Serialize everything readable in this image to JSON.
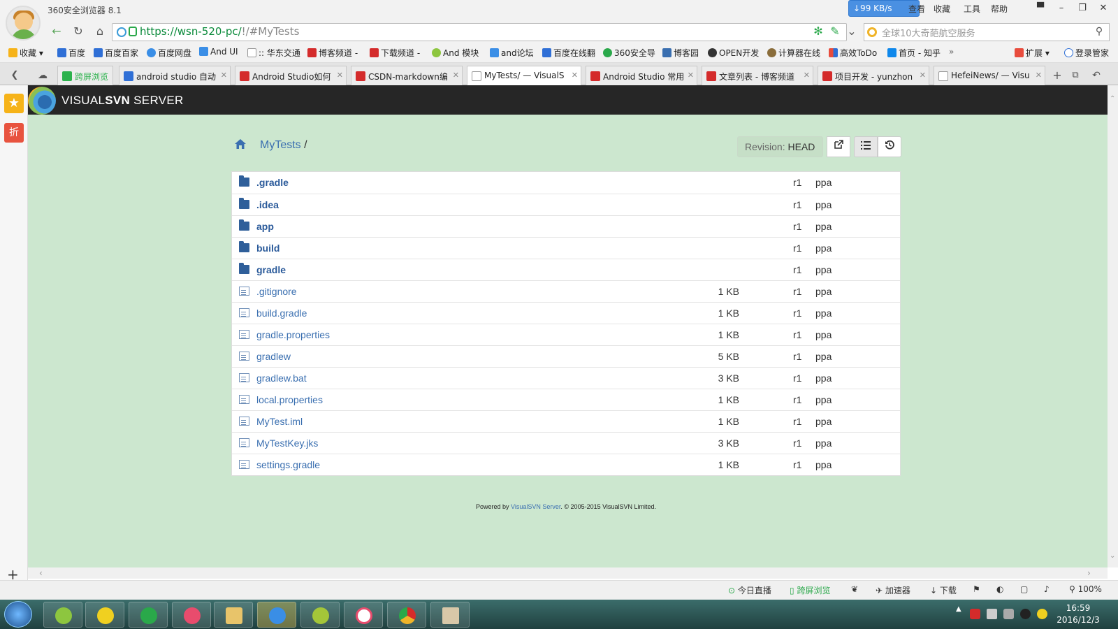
{
  "browser": {
    "app_title": "360安全浏览器 8.1",
    "speed": "↓99 KB/s",
    "menu": [
      "查看",
      "收藏",
      "工具",
      "帮助"
    ],
    "url_prefix": "https://wsn-520-pc/",
    "url_suffix": "!/#MyTests",
    "search_placeholder": "全球10大奇葩航空服务",
    "bookmarks": [
      "收藏",
      "百度",
      "百度百家",
      "百度网盘",
      "And UI",
      ":: 华东交通",
      "博客频道 -",
      "下载频道 -",
      "And 模块",
      "and论坛",
      "百度在线翻",
      "360安全导",
      "博客园",
      "OPEN开发",
      "计算器在线",
      "高效ToDo",
      "首页 - 知乎",
      "扩展",
      "登录管家"
    ],
    "tabs": [
      {
        "label": "跨屏浏览",
        "color": "#2bb24c"
      },
      {
        "label": "android studio 自动",
        "color": "#2f6fd6"
      },
      {
        "label": "Android Studio如何",
        "color": "#d42b2b"
      },
      {
        "label": "CSDN-markdown编",
        "color": "#d42b2b"
      },
      {
        "label": "MyTests/ — VisualS",
        "color": "#999999"
      },
      {
        "label": "Android Studio 常用",
        "color": "#d42b2b"
      },
      {
        "label": "文章列表 - 博客频道",
        "color": "#d42b2b"
      },
      {
        "label": "项目开发 - yunzhon",
        "color": "#d42b2b"
      },
      {
        "label": "HefeiNews/ — Visu",
        "color": "#999999"
      }
    ],
    "sidebar_deal": "折"
  },
  "svn": {
    "brand_light": "VISUAL",
    "brand_bold": "SVN",
    "brand_rest": " SERVER",
    "crumb": "MyTests",
    "crumb_sep": " /",
    "revision_label": "Revision:",
    "revision_value": "HEAD",
    "entries": [
      {
        "name": ".gradle",
        "type": "dir",
        "size": "",
        "rev": "r1",
        "author": "ppa"
      },
      {
        "name": ".idea",
        "type": "dir",
        "size": "",
        "rev": "r1",
        "author": "ppa"
      },
      {
        "name": "app",
        "type": "dir",
        "size": "",
        "rev": "r1",
        "author": "ppa"
      },
      {
        "name": "build",
        "type": "dir",
        "size": "",
        "rev": "r1",
        "author": "ppa"
      },
      {
        "name": "gradle",
        "type": "dir",
        "size": "",
        "rev": "r1",
        "author": "ppa"
      },
      {
        "name": ".gitignore",
        "type": "file",
        "size": "1 KB",
        "rev": "r1",
        "author": "ppa"
      },
      {
        "name": "build.gradle",
        "type": "file",
        "size": "1 KB",
        "rev": "r1",
        "author": "ppa"
      },
      {
        "name": "gradle.properties",
        "type": "file",
        "size": "1 KB",
        "rev": "r1",
        "author": "ppa"
      },
      {
        "name": "gradlew",
        "type": "file",
        "size": "5 KB",
        "rev": "r1",
        "author": "ppa"
      },
      {
        "name": "gradlew.bat",
        "type": "file",
        "size": "3 KB",
        "rev": "r1",
        "author": "ppa"
      },
      {
        "name": "local.properties",
        "type": "file",
        "size": "1 KB",
        "rev": "r1",
        "author": "ppa"
      },
      {
        "name": "MyTest.iml",
        "type": "file",
        "size": "1 KB",
        "rev": "r1",
        "author": "ppa"
      },
      {
        "name": "MyTestKey.jks",
        "type": "file",
        "size": "3 KB",
        "rev": "r1",
        "author": "ppa"
      },
      {
        "name": "settings.gradle",
        "type": "file",
        "size": "1 KB",
        "rev": "r1",
        "author": "ppa"
      }
    ],
    "footer_pre": "Powered by ",
    "footer_link": "VisualSVN Server",
    "footer_post": ". © 2005-2015 VisualSVN Limited."
  },
  "status": {
    "live": "今日直播",
    "cross": "跨屏浏览",
    "accel": "加速器",
    "download": "下载",
    "zoom": "100%"
  },
  "taskbar": {
    "time": "16:59",
    "date": "2016/12/3"
  }
}
